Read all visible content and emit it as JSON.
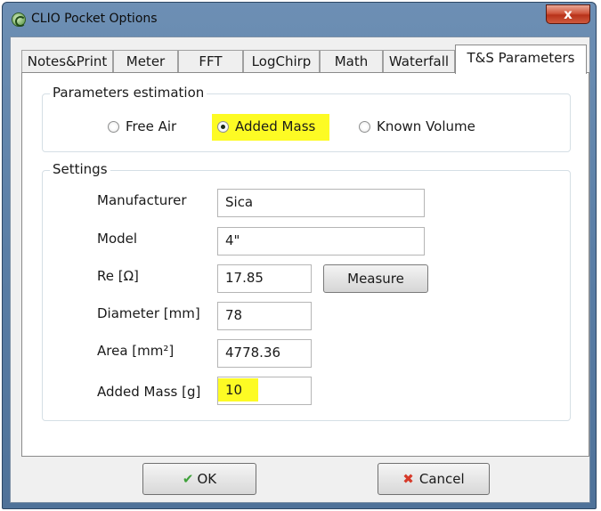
{
  "window": {
    "title": "CLIO Pocket Options",
    "close_symbol": "x"
  },
  "tabs": [
    {
      "label": "Notes&Print",
      "active": false
    },
    {
      "label": "Meter",
      "active": false
    },
    {
      "label": "FFT",
      "active": false
    },
    {
      "label": "LogChirp",
      "active": false
    },
    {
      "label": "Math",
      "active": false
    },
    {
      "label": "Waterfall",
      "active": false
    },
    {
      "label": "T&S Parameters",
      "active": true
    }
  ],
  "estimation": {
    "title": "Parameters estimation",
    "options": [
      {
        "label": "Free Air",
        "checked": false
      },
      {
        "label": "Added Mass",
        "checked": true,
        "highlighted": true
      },
      {
        "label": "Known Volume",
        "checked": false
      }
    ]
  },
  "settings": {
    "title": "Settings",
    "manufacturer": {
      "label": "Manufacturer",
      "value": "Sica"
    },
    "model": {
      "label": "Model",
      "value": "4\""
    },
    "re": {
      "label": "Re [Ω]",
      "value": "17.85"
    },
    "measure_label": "Measure",
    "diameter": {
      "label": "Diameter [mm]",
      "value": "78"
    },
    "area": {
      "label": "Area [mm²]",
      "value": "4778.36"
    },
    "added_mass": {
      "label": "Added Mass [g]",
      "value": "10",
      "highlighted": true
    }
  },
  "buttons": {
    "ok_label": "OK",
    "cancel_label": "Cancel"
  },
  "colors": {
    "highlight": "#fdfb24",
    "title_bar": "#5a7ea6",
    "ok_icon": "#3ea13a",
    "cancel_icon": "#d63a2a"
  },
  "icons": [
    "clio-app-icon",
    "close-icon",
    "checkmark-icon",
    "cancel-x-icon"
  ]
}
